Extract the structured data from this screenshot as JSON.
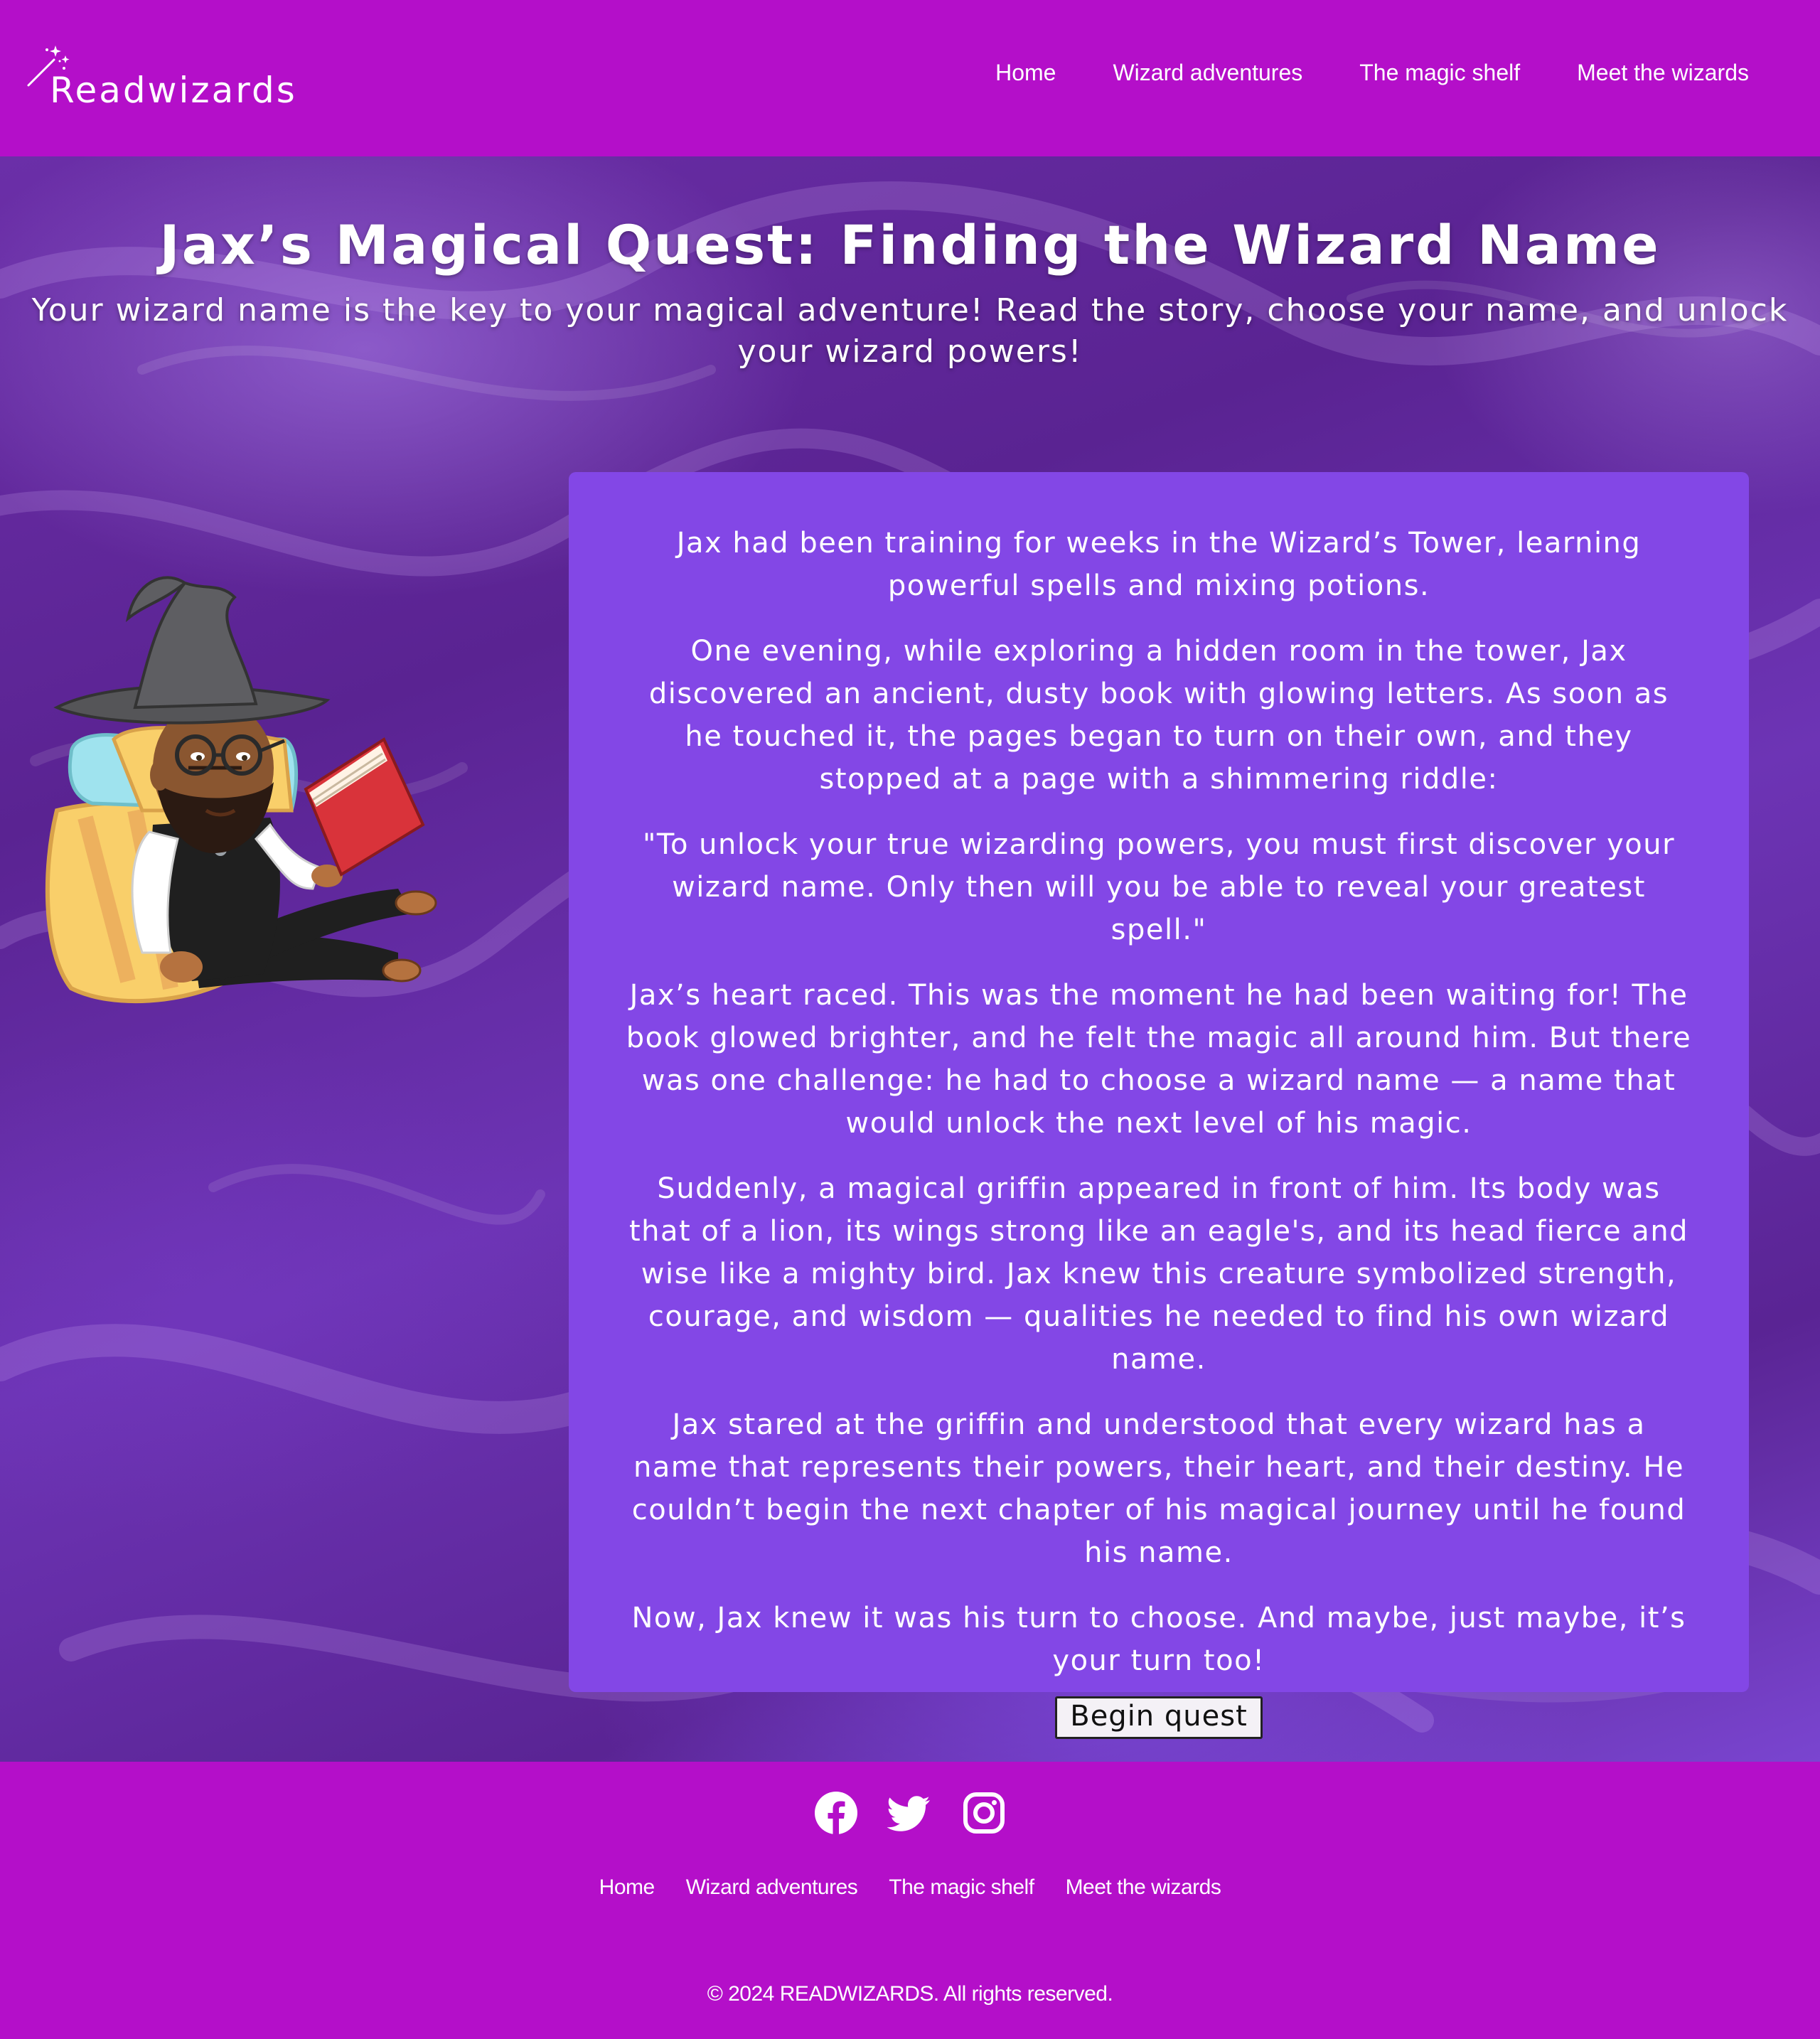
{
  "header": {
    "logo_text": "Readwizards",
    "nav": [
      {
        "label": "Home"
      },
      {
        "label": "Wizard adventures"
      },
      {
        "label": "The magic shelf"
      },
      {
        "label": "Meet the wizards"
      }
    ]
  },
  "hero": {
    "title": "Jax’s Magical Quest: Finding the Wizard Name",
    "subtitle": "Your wizard name is the key to your magical adventure! Read the story, choose your name, and unlock your wizard powers!"
  },
  "story": {
    "paragraphs": [
      "Jax had been training for weeks in the Wizard’s Tower, learning powerful spells and mixing potions.",
      "One evening, while exploring a hidden room in the tower, Jax discovered an ancient, dusty book with glowing letters. As soon as he touched it, the pages began to turn on their own, and they stopped at a page with a shimmering riddle:",
      "\"To unlock your true wizarding powers, you must first discover your wizard name. Only then will you be able to reveal your greatest spell.\"",
      "Jax’s heart raced. This was the moment he had been waiting for! The book glowed brighter, and he felt the magic all around him. But there was one challenge: he had to choose a wizard name — a name that would unlock the next level of his magic.",
      "Suddenly, a magical griffin appeared in front of him. Its body was that of a lion, its wings strong like an eagle's, and its head fierce and wise like a mighty bird. Jax knew this creature symbolized strength, courage, and wisdom — qualities he needed to find his own wizard name.",
      "Jax stared at the griffin and understood that every wizard has a name that represents their powers, their heart, and their destiny. He couldn’t begin the next chapter of his magical journey until he found his name.",
      "Now, Jax knew it was his turn to choose. And maybe, just maybe, it’s your turn too!"
    ],
    "button_label": "Begin quest"
  },
  "footer": {
    "social": [
      {
        "icon": "facebook-icon"
      },
      {
        "icon": "twitter-icon"
      },
      {
        "icon": "instagram-icon"
      }
    ],
    "nav": [
      {
        "label": "Home"
      },
      {
        "label": "Wizard adventures"
      },
      {
        "label": "The magic shelf"
      },
      {
        "label": "Meet the wizards"
      }
    ],
    "copyright": "© 2024 READWIZARDS. All rights reserved."
  },
  "colors": {
    "header_bg": "#b40fc9",
    "card_bg": "#8347e6",
    "text": "#ffffff"
  }
}
